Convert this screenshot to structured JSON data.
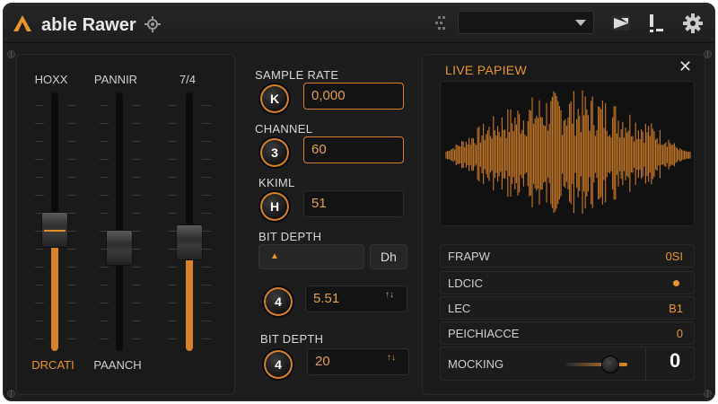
{
  "app": {
    "title": "able Rawer"
  },
  "faders": [
    {
      "label": "HOXX",
      "bottom_label": "DRCATI",
      "level": 0.47
    },
    {
      "label": "PANNIR",
      "bottom_label": "PAANCH",
      "level": 0.4
    },
    {
      "label": "7/4",
      "bottom_label": "",
      "level": 0.42
    }
  ],
  "controls": {
    "sample_rate": {
      "label": "SAMPLE RATE",
      "knob": "K",
      "value": "0,000"
    },
    "channel": {
      "label": "CHANNEL",
      "knob": "3",
      "value": "60"
    },
    "kiml": {
      "label": "KKIML",
      "knob": "H",
      "value": "51"
    },
    "bit_depth_1": {
      "label": "BIT DEPTH",
      "button_left": "▲",
      "button_right": "Dh"
    },
    "knob4": {
      "knob": "4",
      "value": "5.51",
      "stepper": "↑↓"
    },
    "bit_depth_2": {
      "label": "BIT DEPTH",
      "knob": "4",
      "value": "20",
      "stepper": "↑↓"
    }
  },
  "preview": {
    "title": "LIVE PAPIEW",
    "close_label": "✕"
  },
  "properties": [
    {
      "label": "FRAPW",
      "value": "0SI"
    },
    {
      "label": "LDCIC",
      "value": "●"
    },
    {
      "label": "LEC",
      "value": "B1"
    },
    {
      "label": "PEICHIACCE",
      "value": "0"
    }
  ],
  "mocking": {
    "label": "MOCKING",
    "value": "0",
    "level": 0.72
  },
  "colors": {
    "accent": "#e8962c",
    "background": "#1d1d1d"
  },
  "icons": [
    "logo-icon",
    "gear-icon",
    "grid-icon",
    "share-icon",
    "meter-icon",
    "settings-icon"
  ]
}
